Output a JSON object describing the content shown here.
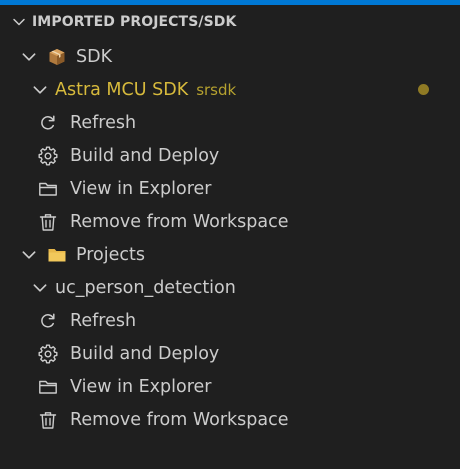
{
  "panel": {
    "title": "IMPORTED PROJECTS/SDK"
  },
  "colors": {
    "accent": "#0078d4",
    "background": "#1f1f1f",
    "text": "#cccccc",
    "highlight_text": "#d7ba3c",
    "description_text": "#b5a12f",
    "status_dot": "#8f7a24",
    "folder": "#e8b84a"
  },
  "tree": {
    "sdk_group": {
      "label": "SDK",
      "icon": "package-icon",
      "sdk": {
        "label": "Astra MCU SDK",
        "description": "srsdk",
        "status": "modified-dot",
        "actions": [
          {
            "label": "Refresh",
            "icon": "refresh-icon"
          },
          {
            "label": "Build and Deploy",
            "icon": "gear-icon"
          },
          {
            "label": "View in Explorer",
            "icon": "folder-outline-icon"
          },
          {
            "label": "Remove from Workspace",
            "icon": "trash-icon"
          }
        ]
      }
    },
    "projects_group": {
      "label": "Projects",
      "icon": "folder-icon",
      "project": {
        "label": "uc_person_detection",
        "actions": [
          {
            "label": "Refresh",
            "icon": "refresh-icon"
          },
          {
            "label": "Build and Deploy",
            "icon": "gear-icon"
          },
          {
            "label": "View in Explorer",
            "icon": "folder-outline-icon"
          },
          {
            "label": "Remove from Workspace",
            "icon": "trash-icon"
          }
        ]
      }
    }
  }
}
